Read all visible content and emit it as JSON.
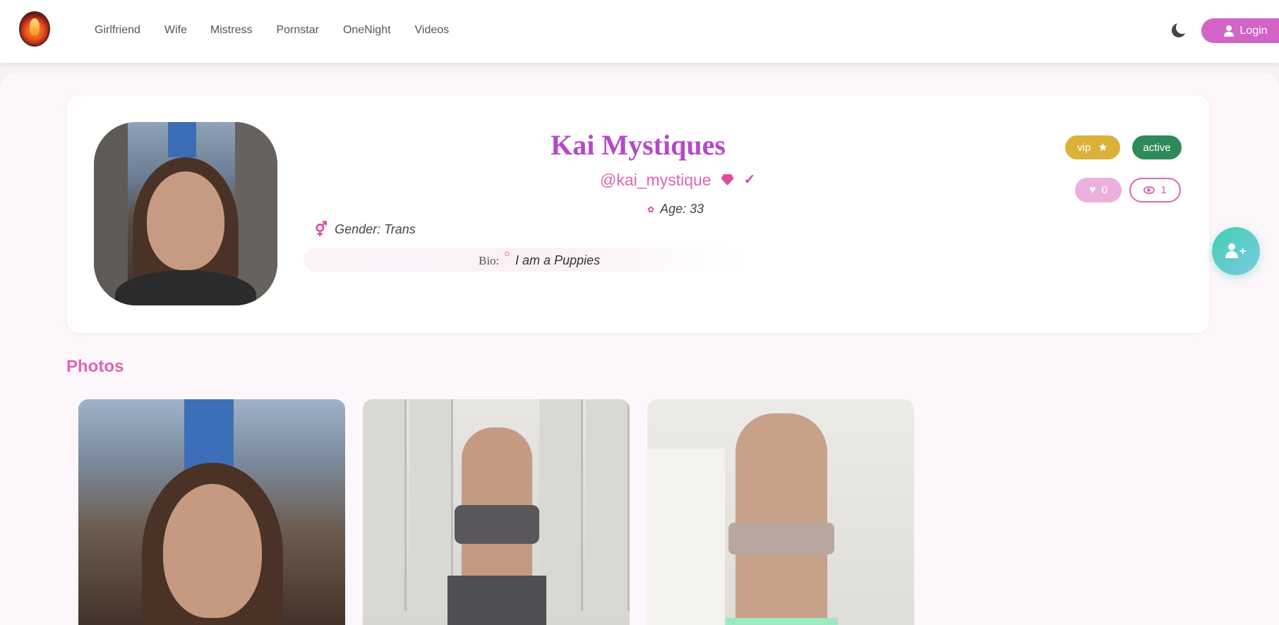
{
  "nav": {
    "links": [
      "Girlfriend",
      "Wife",
      "Mistress",
      "Pornstar",
      "OneNight",
      "Videos"
    ],
    "login_label": "Login",
    "icons": {
      "theme": "moon-icon",
      "login": "user-icon",
      "logo": "flame-logo"
    }
  },
  "profile": {
    "name": "Kai Mystiques",
    "handle": "@kai_mystique",
    "age": "Age: 33",
    "gender": "Gender: Trans",
    "bio_label": "Bio:",
    "bio_text": "I am a Puppies",
    "badges": {
      "vip": "vip",
      "status": "active"
    },
    "likes": "0",
    "views": "1",
    "icons": {
      "verified": [
        "gem-icon",
        "check-icon"
      ],
      "age": "flower-icon",
      "gender": "gender-icon",
      "likes": "heart-icon",
      "views": "eye-icon",
      "vip": "star-icon",
      "follow": "add-user-icon"
    }
  },
  "photos": {
    "heading": "Photos",
    "count": 3
  },
  "colors": {
    "accent": "#e064b2",
    "name": "#b44ac8",
    "login_button": "#d363c5",
    "vip": "#d9b13b",
    "active": "#2f8a5a",
    "follow_fab": "#3fd0b0"
  }
}
